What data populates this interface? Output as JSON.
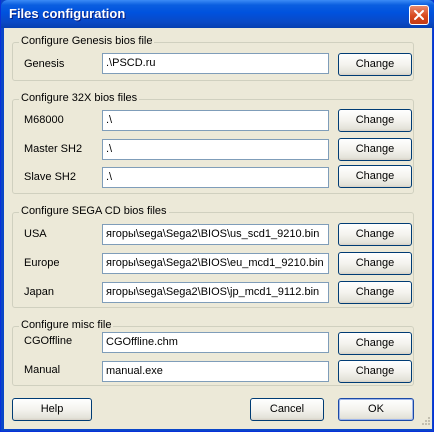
{
  "window": {
    "title": "Files configuration"
  },
  "groups": {
    "genesis": {
      "title": "Configure Genesis bios file",
      "rows": [
        {
          "label": "Genesis",
          "value": ".\\PSCD.ru",
          "button": "Change"
        }
      ]
    },
    "s32x": {
      "title": "Configure 32X bios files",
      "rows": [
        {
          "label": "M68000",
          "value": ".\\",
          "button": "Change"
        },
        {
          "label": "Master SH2",
          "value": ".\\",
          "button": "Change"
        },
        {
          "label": "Slave SH2",
          "value": ".\\",
          "button": "Change"
        }
      ]
    },
    "segacd": {
      "title": "Configure SEGA CD bios files",
      "rows": [
        {
          "label": "USA",
          "value": "ягоры\\sega\\Sega2\\BIOS\\us_scd1_9210.bin",
          "button": "Change"
        },
        {
          "label": "Europe",
          "value": "ягоры\\sega\\Sega2\\BIOS\\eu_mcd1_9210.bin",
          "button": "Change"
        },
        {
          "label": "Japan",
          "value": "ягоры\\sega\\Sega2\\BIOS\\jp_mcd1_9112.bin",
          "button": "Change"
        }
      ]
    },
    "misc": {
      "title": "Configure misc file",
      "rows": [
        {
          "label": "CGOffline",
          "value": "CGOffline.chm",
          "button": "Change"
        },
        {
          "label": "Manual",
          "value": "manual.exe",
          "button": "Change"
        }
      ]
    }
  },
  "footer": {
    "help": "Help",
    "cancel": "Cancel",
    "ok": "OK"
  },
  "colors": {
    "titlebar": "#0a5ee0",
    "dialog_bg": "#ece9d8",
    "field_border": "#7f9db9",
    "button_border": "#003c74"
  }
}
